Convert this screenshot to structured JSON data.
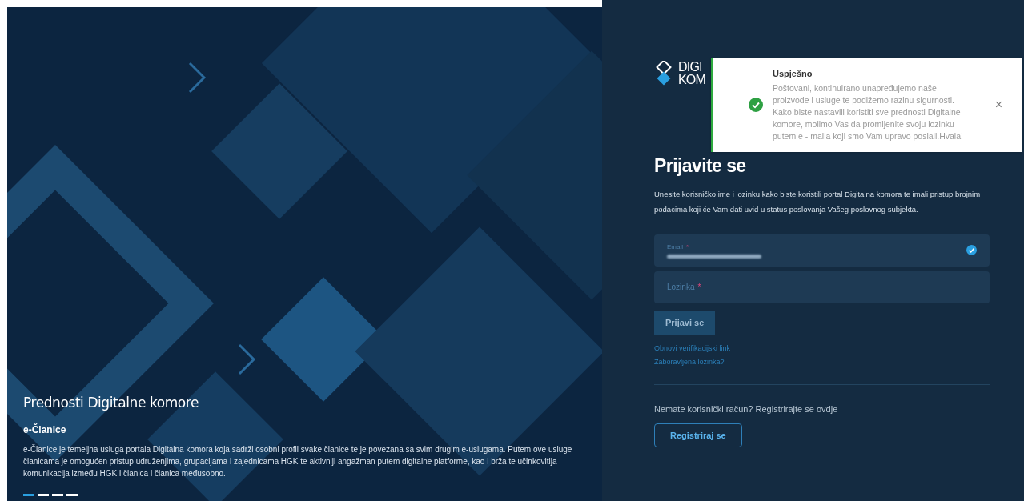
{
  "hero": {
    "title": "Prednosti Digitalne komore",
    "subtitle": "e-Članice",
    "text": "e-Članice je temeljna usluga portala Digitalna komora koja sadrži osobni profil svake članice te je povezana sa svim drugim e-uslugama. Putem ove usluge članicama je omogućen pristup udruženjima, grupacijama i zajednicama HGK te aktivniji angažman putem digitalne platforme, kao i brža te učinkovitija komunikacija između HGK i članica i članica međusobno.",
    "slides": [
      {
        "selected": true
      },
      {
        "selected": false
      },
      {
        "selected": false
      },
      {
        "selected": false
      }
    ]
  },
  "logo": {
    "line_1": "DIGI",
    "line_2": "KOM"
  },
  "toast": {
    "title": "Uspješno",
    "message": "Poštovani, kontinuirano unapređujemo naše proizvode i usluge te podižemo razinu sigurnosti. Kako biste nastavili koristiti sve prednosti Digitalne komore, molimo Vas da promijenite svoju lozinku putem e - maila koji smo Vam upravo poslali.Hvala!",
    "close": "×"
  },
  "login": {
    "title": "Prijavite se",
    "intro": "Unesite korisničko ime i lozinku kako biste koristili portal Digitalna komora te imali pristup brojnim podacima koji će Vam dati uvid u status poslovanja Vašeg poslovnog subjekta.",
    "fields": [
      {
        "label": "Email",
        "required_mark": "*",
        "valid": true,
        "filled": true
      },
      {
        "label": "Lozinka",
        "required_mark": "*",
        "valid": false,
        "filled": false
      }
    ],
    "submit": "Prijavi se",
    "links": [
      "Obnovi verifikacijski link",
      "Zaboravljena lozinka?"
    ],
    "register_prompt": "Nemate korisnički račun? Registrirajte se ovdje",
    "register": "Registriraj se"
  }
}
